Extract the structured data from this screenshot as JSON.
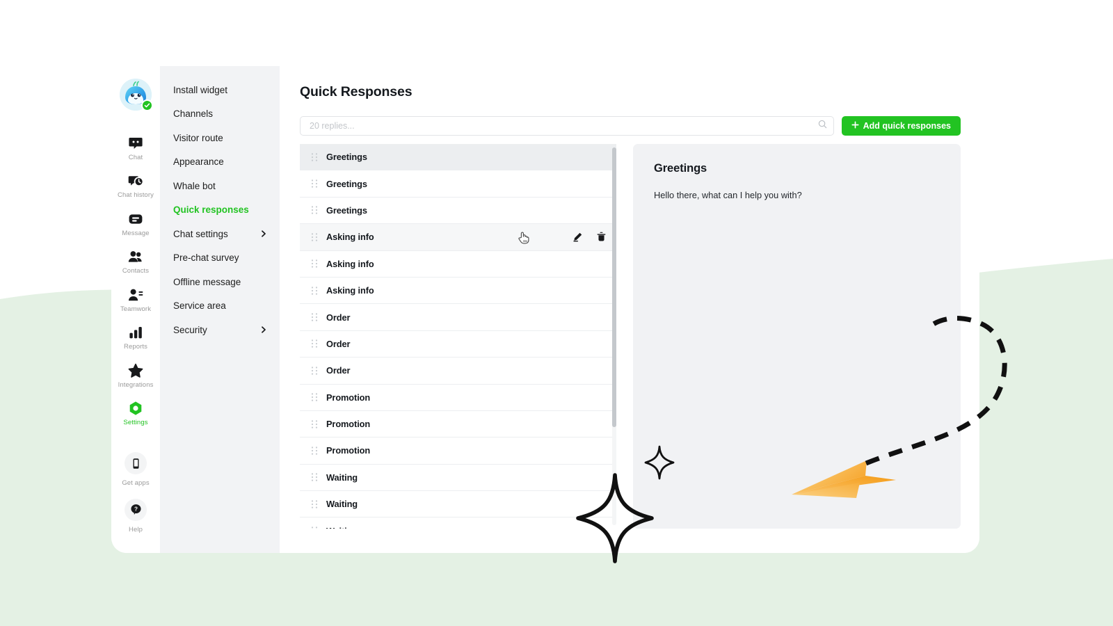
{
  "theme": {
    "accent_green": "#22c322",
    "bg_green_pale": "#e7f3e7",
    "panel_grey": "#f2f3f5",
    "detail_grey": "#f1f2f4",
    "text_dark": "#15191e",
    "text_muted": "#9a9a9a",
    "plane_orange": "#f5a623"
  },
  "rail": {
    "avatar": {
      "icon": "whale-mascot-avatar",
      "status": "online",
      "status_icon": "check-badge-icon"
    },
    "items": [
      {
        "id": "chat",
        "label": "Chat",
        "icon": "chat-bubble-icon",
        "active": false
      },
      {
        "id": "chat-history",
        "label": "Chat history",
        "icon": "history-clock-icon",
        "active": false
      },
      {
        "id": "message",
        "label": "Message",
        "icon": "message-icon",
        "active": false
      },
      {
        "id": "contacts",
        "label": "Contacts",
        "icon": "contacts-icon",
        "active": false
      },
      {
        "id": "teamwork",
        "label": "Teamwork",
        "icon": "teamwork-icon",
        "active": false
      },
      {
        "id": "reports",
        "label": "Reports",
        "icon": "bar-chart-icon",
        "active": false
      },
      {
        "id": "integrations",
        "label": "Integrations",
        "icon": "star-icon",
        "active": false
      },
      {
        "id": "settings",
        "label": "Settings",
        "icon": "gear-hex-icon",
        "active": true
      }
    ],
    "bottom_items": [
      {
        "id": "get-apps",
        "label": "Get apps",
        "icon": "mobile-phone-icon"
      },
      {
        "id": "help",
        "label": "Help",
        "icon": "question-help-icon"
      }
    ]
  },
  "subnav": {
    "items": [
      {
        "id": "install-widget",
        "label": "Install widget",
        "active": false,
        "chevron": false
      },
      {
        "id": "channels",
        "label": "Channels",
        "active": false,
        "chevron": false
      },
      {
        "id": "visitor-route",
        "label": "Visitor route",
        "active": false,
        "chevron": false
      },
      {
        "id": "appearance",
        "label": "Appearance",
        "active": false,
        "chevron": false
      },
      {
        "id": "whale-bot",
        "label": "Whale bot",
        "active": false,
        "chevron": false
      },
      {
        "id": "quick-responses",
        "label": "Quick responses",
        "active": true,
        "chevron": false
      },
      {
        "id": "chat-settings",
        "label": "Chat settings",
        "active": false,
        "chevron": true
      },
      {
        "id": "pre-chat-survey",
        "label": "Pre-chat survey",
        "active": false,
        "chevron": false
      },
      {
        "id": "offline-message",
        "label": "Offline message",
        "active": false,
        "chevron": false
      },
      {
        "id": "service-area",
        "label": "Service area",
        "active": false,
        "chevron": false
      },
      {
        "id": "security",
        "label": "Security",
        "active": false,
        "chevron": true
      }
    ]
  },
  "main": {
    "title": "Quick Responses",
    "search": {
      "value": "",
      "placeholder": "20 replies...",
      "icon": "search-icon"
    },
    "add_button": {
      "label": "Add quick responses",
      "icon": "plus-icon"
    },
    "list": {
      "rows": [
        {
          "label": "Greetings",
          "selected": true,
          "hovered": false
        },
        {
          "label": "Greetings",
          "selected": false,
          "hovered": false
        },
        {
          "label": "Greetings",
          "selected": false,
          "hovered": false
        },
        {
          "label": "Asking info",
          "selected": false,
          "hovered": true
        },
        {
          "label": "Asking info",
          "selected": false,
          "hovered": false
        },
        {
          "label": "Asking info",
          "selected": false,
          "hovered": false
        },
        {
          "label": "Order",
          "selected": false,
          "hovered": false
        },
        {
          "label": "Order",
          "selected": false,
          "hovered": false
        },
        {
          "label": "Order",
          "selected": false,
          "hovered": false
        },
        {
          "label": "Promotion",
          "selected": false,
          "hovered": false
        },
        {
          "label": "Promotion",
          "selected": false,
          "hovered": false
        },
        {
          "label": "Promotion",
          "selected": false,
          "hovered": false
        },
        {
          "label": "Waiting",
          "selected": false,
          "hovered": false
        },
        {
          "label": "Waiting",
          "selected": false,
          "hovered": false
        },
        {
          "label": "Waiting",
          "selected": false,
          "hovered": false
        }
      ],
      "row_icons": {
        "drag": "drag-handle-icon",
        "edit": "edit-pencil-icon",
        "delete": "trash-delete-icon"
      },
      "cursor": "pointing-hand-cursor"
    },
    "detail": {
      "title": "Greetings",
      "body": "Hello there, what can I help you with?"
    }
  },
  "decorations": [
    {
      "id": "star-big",
      "name": "sparkle-star-large"
    },
    {
      "id": "star-small",
      "name": "sparkle-star-small"
    },
    {
      "id": "plane",
      "name": "paper-plane-icon"
    },
    {
      "id": "dash-path",
      "name": "dashed-flight-path"
    }
  ]
}
